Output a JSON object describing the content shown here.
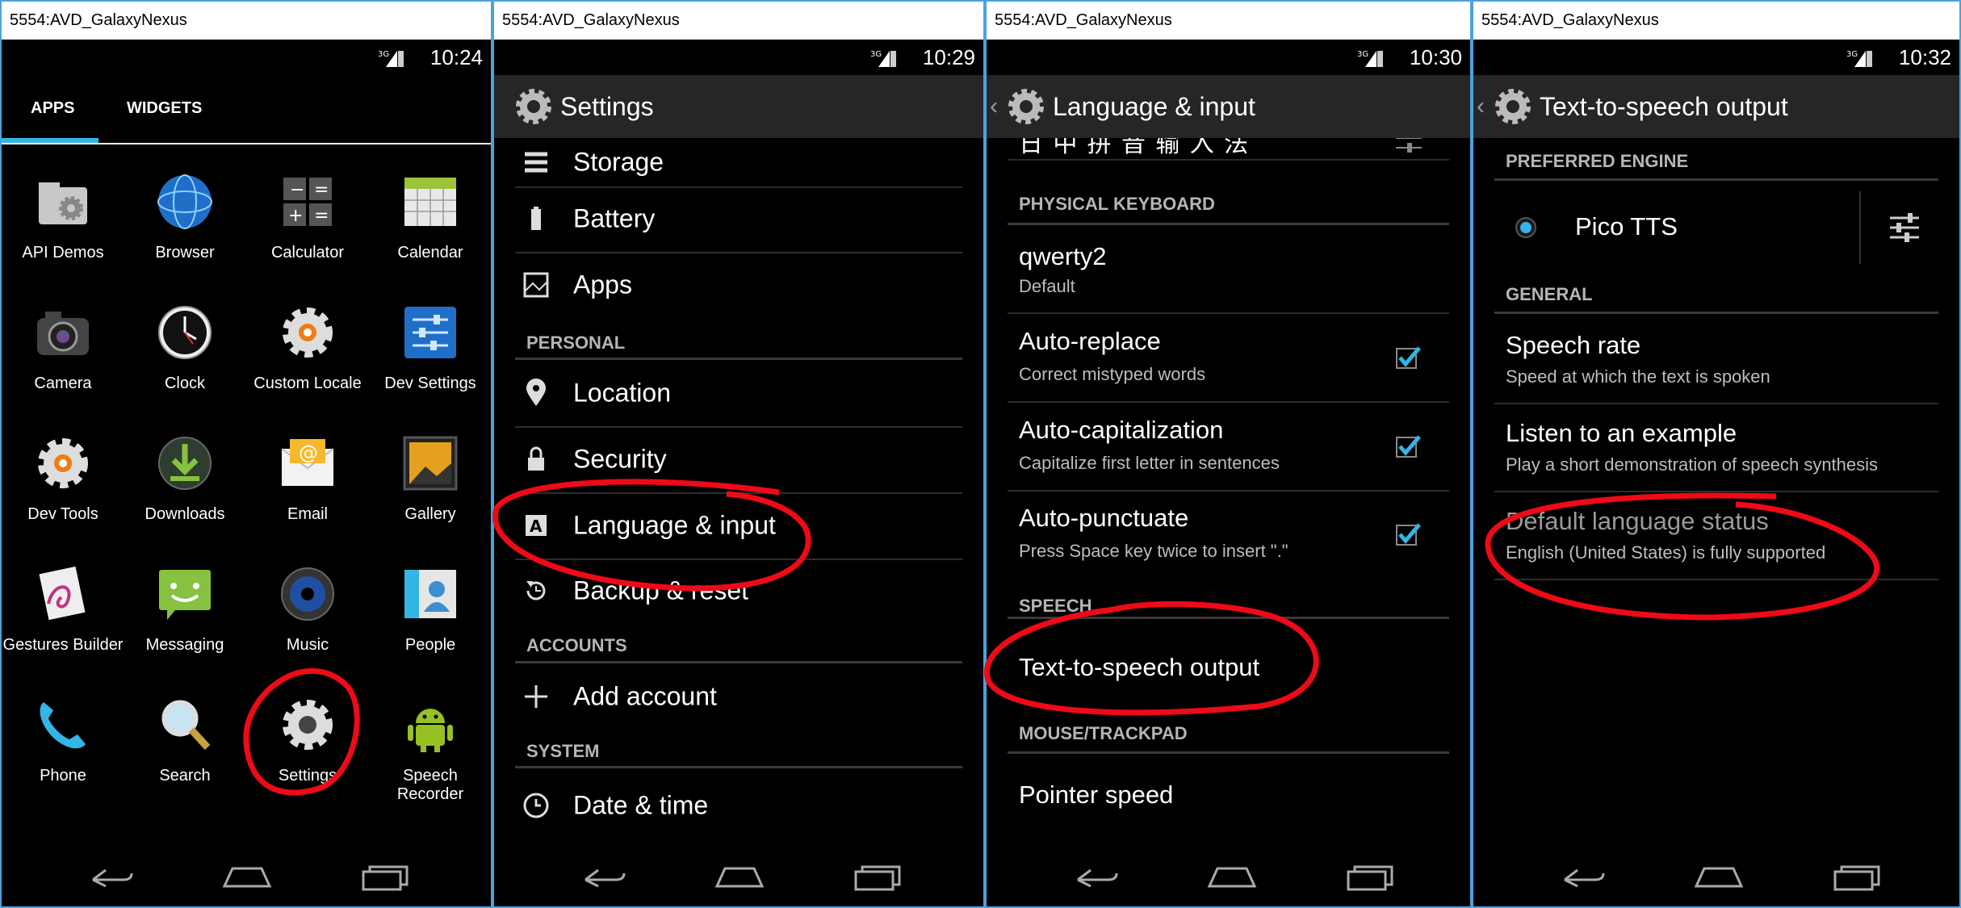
{
  "colors": {
    "accent": "#33b5e5",
    "annotation": "#ee0a16",
    "panel_border": "#4aa3df"
  },
  "panels": [
    {
      "window_title": "5554:AVD_GalaxyNexus",
      "time": "10:24",
      "tabs": [
        "APPS",
        "WIDGETS"
      ],
      "apps": [
        {
          "label": "API Demos",
          "icon": "folder-gear-icon"
        },
        {
          "label": "Browser",
          "icon": "globe-icon"
        },
        {
          "label": "Calculator",
          "icon": "calculator-icon"
        },
        {
          "label": "Calendar",
          "icon": "calendar-icon"
        },
        {
          "label": "Camera",
          "icon": "camera-icon"
        },
        {
          "label": "Clock",
          "icon": "clock-icon"
        },
        {
          "label": "Custom Locale",
          "icon": "gear-orange-icon"
        },
        {
          "label": "Dev Settings",
          "icon": "sliders-icon"
        },
        {
          "label": "Dev Tools",
          "icon": "gear-orange-icon"
        },
        {
          "label": "Downloads",
          "icon": "download-icon"
        },
        {
          "label": "Email",
          "icon": "email-icon"
        },
        {
          "label": "Gallery",
          "icon": "gallery-icon"
        },
        {
          "label": "Gestures Builder",
          "icon": "gestures-icon"
        },
        {
          "label": "Messaging",
          "icon": "message-icon"
        },
        {
          "label": "Music",
          "icon": "speaker-icon"
        },
        {
          "label": "People",
          "icon": "people-icon"
        },
        {
          "label": "Phone",
          "icon": "phone-icon"
        },
        {
          "label": "Search",
          "icon": "search-icon"
        },
        {
          "label": "Settings",
          "icon": "gear-icon"
        },
        {
          "label": "Speech Recorder",
          "icon": "android-icon"
        }
      ]
    },
    {
      "window_title": "5554:AVD_GalaxyNexus",
      "time": "10:29",
      "title": "Settings",
      "items": [
        {
          "type": "row",
          "label": "Storage",
          "icon": "storage-icon"
        },
        {
          "type": "row",
          "label": "Battery",
          "icon": "battery-icon"
        },
        {
          "type": "row",
          "label": "Apps",
          "icon": "apps-icon"
        },
        {
          "type": "section",
          "label": "PERSONAL"
        },
        {
          "type": "row",
          "label": "Location",
          "icon": "location-pin-icon"
        },
        {
          "type": "row",
          "label": "Security",
          "icon": "lock-icon"
        },
        {
          "type": "row",
          "label": "Language & input",
          "icon": "language-icon"
        },
        {
          "type": "row",
          "label": "Backup & reset",
          "icon": "backup-icon"
        },
        {
          "type": "section",
          "label": "ACCOUNTS"
        },
        {
          "type": "row",
          "label": "Add account",
          "icon": "plus-icon"
        },
        {
          "type": "section",
          "label": "SYSTEM"
        },
        {
          "type": "row",
          "label": "Date & time",
          "icon": "clock-icon"
        }
      ]
    },
    {
      "window_title": "5554:AVD_GalaxyNexus",
      "time": "10:30",
      "title": "Language & input",
      "partial_top": "日 中 拼 音 输 入 法",
      "sections": {
        "physical": "PHYSICAL KEYBOARD",
        "speech": "SPEECH",
        "mouse": "MOUSE/TRACKPAD"
      },
      "keyboard": {
        "title": "qwerty2",
        "subtitle": "Default"
      },
      "options": [
        {
          "title": "Auto-replace",
          "subtitle": "Correct mistyped words",
          "checked": true
        },
        {
          "title": "Auto-capitalization",
          "subtitle": "Capitalize first letter in sentences",
          "checked": true
        },
        {
          "title": "Auto-punctuate",
          "subtitle": "Press Space key twice to insert \".\"",
          "checked": true
        }
      ],
      "tts": "Text-to-speech output",
      "pointer": "Pointer speed"
    },
    {
      "window_title": "5554:AVD_GalaxyNexus",
      "time": "10:32",
      "title": "Text-to-speech output",
      "sections": {
        "engine": "PREFERRED ENGINE",
        "general": "GENERAL"
      },
      "engine": "Pico TTS",
      "items": [
        {
          "title": "Speech rate",
          "subtitle": "Speed at which the text is spoken"
        },
        {
          "title": "Listen to an example",
          "subtitle": "Play a short demonstration of speech synthesis"
        },
        {
          "title": "Default language status",
          "subtitle": "English (United States) is fully supported"
        }
      ]
    }
  ]
}
